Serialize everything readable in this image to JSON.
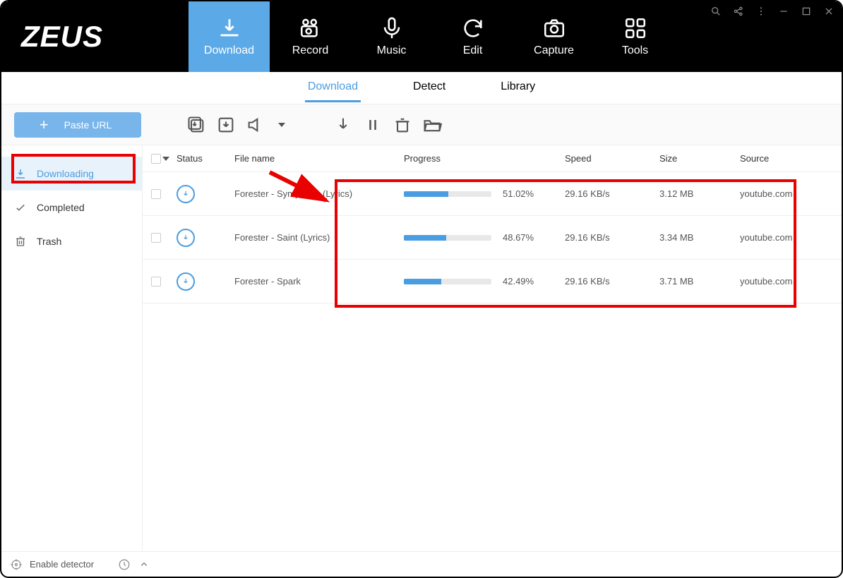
{
  "app": {
    "logo": "ZEUS"
  },
  "main_nav": {
    "download": "Download",
    "record": "Record",
    "music": "Music",
    "edit": "Edit",
    "capture": "Capture",
    "tools": "Tools"
  },
  "subtabs": {
    "download": "Download",
    "detect": "Detect",
    "library": "Library"
  },
  "toolbar": {
    "paste_url": "Paste URL"
  },
  "sidebar": {
    "downloading": "Downloading",
    "completed": "Completed",
    "trash": "Trash"
  },
  "table": {
    "headers": {
      "status": "Status",
      "file_name": "File name",
      "progress": "Progress",
      "speed": "Speed",
      "size": "Size",
      "source": "Source"
    },
    "rows": [
      {
        "file": "Forester - Symphony (Lyrics)",
        "percent": "51.02%",
        "pct_num": 51.02,
        "speed": "29.16 KB/s",
        "size": "3.12 MB",
        "source": "youtube.com"
      },
      {
        "file": "Forester - Saint (Lyrics)",
        "percent": "48.67%",
        "pct_num": 48.67,
        "speed": "29.16 KB/s",
        "size": "3.34 MB",
        "source": "youtube.com"
      },
      {
        "file": "Forester - Spark",
        "percent": "42.49%",
        "pct_num": 42.49,
        "speed": "29.16 KB/s",
        "size": "3.71 MB",
        "source": "youtube.com"
      }
    ]
  },
  "bottom": {
    "enable_detector": "Enable detector"
  }
}
